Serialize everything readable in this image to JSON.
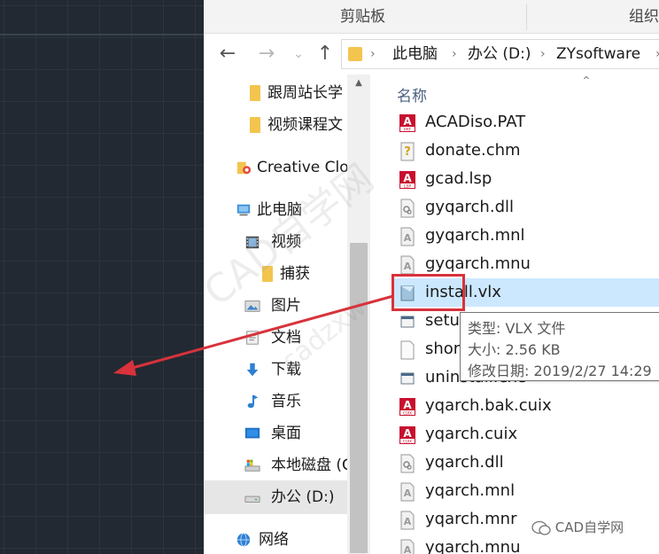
{
  "ribbon": {
    "clipboard": "剪贴板",
    "organize": "组织"
  },
  "address": {
    "parts": [
      "此电脑",
      "办公 (D:)",
      "ZYsoftware"
    ]
  },
  "nav_pane": {
    "items": [
      {
        "label": "跟周站长学",
        "icon": "folder-icon"
      },
      {
        "label": "视频课程文",
        "icon": "folder-icon"
      },
      {
        "label": "Creative Clo",
        "icon": "creative-cloud-icon"
      },
      {
        "label": "此电脑",
        "icon": "computer-icon"
      },
      {
        "label": "视频",
        "icon": "video-library-icon"
      },
      {
        "label": "捕获",
        "icon": "folder-icon"
      },
      {
        "label": "图片",
        "icon": "pictures-icon"
      },
      {
        "label": "文档",
        "icon": "documents-icon"
      },
      {
        "label": "下载",
        "icon": "download-icon"
      },
      {
        "label": "音乐",
        "icon": "music-icon"
      },
      {
        "label": "桌面",
        "icon": "desktop-icon"
      },
      {
        "label": "本地磁盘 (C",
        "icon": "local-disk-icon"
      },
      {
        "label": "办公 (D:)",
        "icon": "drive-icon"
      },
      {
        "label": "网络",
        "icon": "network-icon"
      }
    ]
  },
  "file_list": {
    "column_header": "名称",
    "files": [
      {
        "name": "ACADiso.PAT",
        "icon": "autocad-pat-icon"
      },
      {
        "name": "donate.chm",
        "icon": "help-file-icon"
      },
      {
        "name": "gcad.lsp",
        "icon": "autocad-lsp-icon"
      },
      {
        "name": "gyqarch.dll",
        "icon": "dll-file-icon"
      },
      {
        "name": "gyqarch.mnl",
        "icon": "autocad-file-icon"
      },
      {
        "name": "gyqarch.mnu",
        "icon": "autocad-file-icon"
      },
      {
        "name": "install.vlx",
        "icon": "vlx-file-icon"
      },
      {
        "name": "setu",
        "icon": "setup-icon"
      },
      {
        "name": "shor",
        "icon": "blank-file-icon"
      },
      {
        "name": "uninstall.exe",
        "icon": "setup-icon"
      },
      {
        "name": "yqarch.bak.cuix",
        "icon": "autocad-cuix-icon"
      },
      {
        "name": "yqarch.cuix",
        "icon": "autocad-cuix-icon"
      },
      {
        "name": "yqarch.dll",
        "icon": "dll-file-icon"
      },
      {
        "name": "yqarch.mnl",
        "icon": "autocad-file-icon"
      },
      {
        "name": "yqarch.mnr",
        "icon": "autocad-file-icon"
      },
      {
        "name": "yqarch.mnu",
        "icon": "autocad-file-icon"
      }
    ],
    "selected_file": "install.vlx"
  },
  "tooltip": {
    "type": "类型: VLX 文件",
    "size": "大小: 2.56 KB",
    "modified": "修改日期: 2019/2/27 14:29"
  },
  "watermark": {
    "text": "CAD自学网",
    "url_fragment": "cadzxw",
    "diag": "CAD自学网"
  },
  "colors": {
    "annotation_red": "#d8323c",
    "selection": "#cce8ff",
    "folder": "#f3c54f"
  }
}
